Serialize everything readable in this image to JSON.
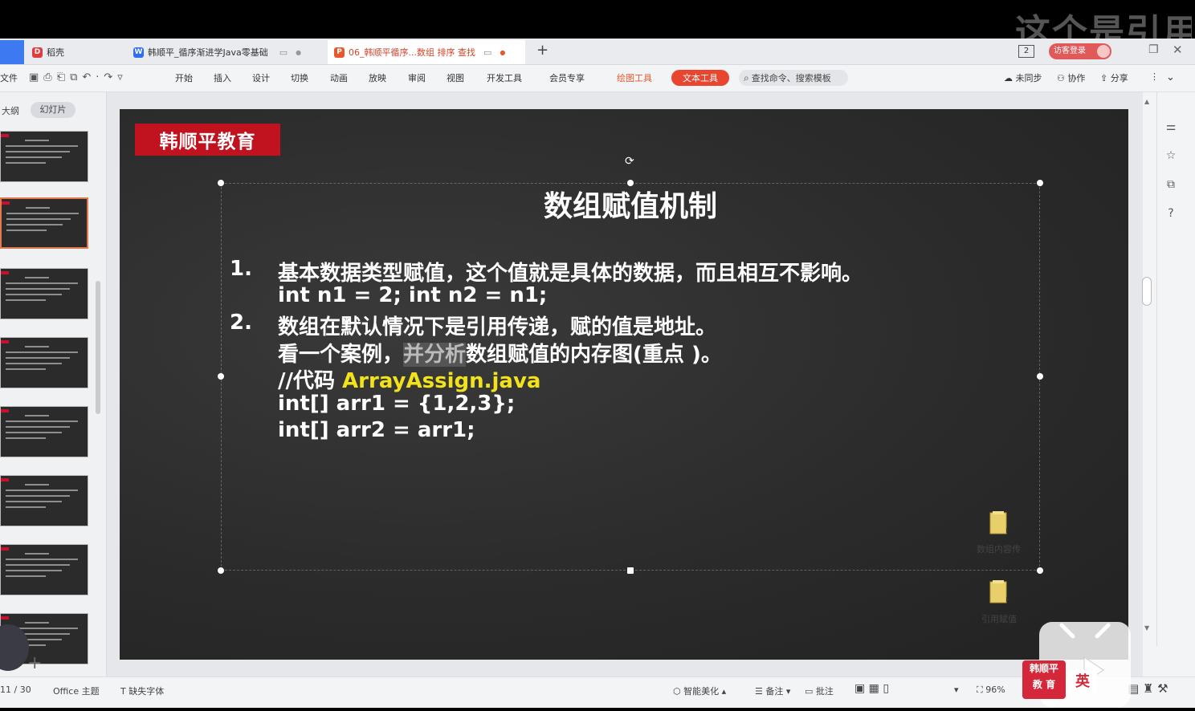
{
  "watermark": "这个是引用",
  "tabs": [
    {
      "label": "稻壳",
      "icon": "D",
      "color": "#e23c3c"
    },
    {
      "label": "韩顺平_循序渐进学Java零基础",
      "icon": "W",
      "color": "#2e6ef2"
    },
    {
      "label": "06_韩顺平循序...数组 排序 查找",
      "icon": "P",
      "color": "#e8582b"
    }
  ],
  "tab_add": "+",
  "window": {
    "badge": "2",
    "visitor": "访客登录"
  },
  "ribbon": {
    "file": "文件",
    "menus": [
      "开始",
      "插入",
      "设计",
      "切换",
      "动画",
      "放映",
      "审阅",
      "视图",
      "开发工具",
      "会员专享"
    ],
    "drawing_tools": "绘图工具",
    "text_tools": "文本工具",
    "search": "查找命令、搜索模板",
    "not_synced": "未同步",
    "collab": "协作",
    "share": "分享"
  },
  "left_panel": {
    "outline_tab": "大纲",
    "slides_tab": "幻灯片",
    "add": "+"
  },
  "slide": {
    "logo": "韩顺平教育",
    "title": "数组赋值机制",
    "items": [
      {
        "num": "1.",
        "lines": [
          "基本数据类型赋值，这个值就是具体的数据，而且相互不影响。",
          "int n1 = 2; int n2 = n1;"
        ]
      },
      {
        "num": "2.",
        "lines": [
          "数组在默认情况下是引用传递，赋的值是地址。"
        ]
      }
    ],
    "case_prefix": "看一个案例，",
    "case_highlight": "并分析",
    "case_suffix": "数组赋值的内存图(重点 )。",
    "code_prefix": "//代码 ",
    "code_file": "ArrayAssign.java",
    "code_lines": [
      "int[] arr1 = {1,2,3};",
      "int[] arr2 = arr1;"
    ],
    "folders": [
      "数组内容传",
      "引用赋值"
    ]
  },
  "status": {
    "slide_count": "11 / 30",
    "theme": "Office 主题",
    "missing_font": "缺失字体",
    "beautify": "智能美化",
    "notes": "备注",
    "comments": "批注",
    "zoom": "96%"
  },
  "overlay": {
    "red_logo_1": "韩顺平",
    "red_logo_2": "教  育",
    "lang": "英"
  },
  "colors": {
    "accent": "#e2794f",
    "text_tools": "#e8462f",
    "logo_red": "#c0121f",
    "code_yellow": "#f1e21b"
  }
}
